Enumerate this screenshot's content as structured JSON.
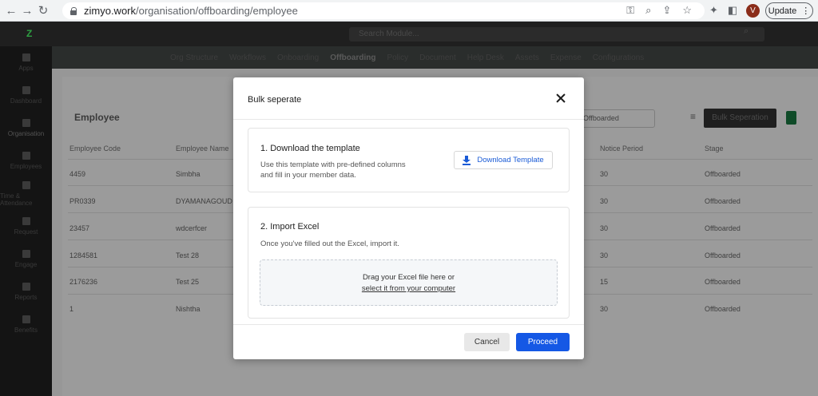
{
  "browser": {
    "url_domain": "zimyo.work",
    "url_path": "/organisation/offboarding/employee",
    "profile_initial": "V",
    "update_label": "Update"
  },
  "app": {
    "search_placeholder": "Search Module...",
    "menu": [
      "Org Structure",
      "Workflows",
      "Onboarding",
      "Offboarding",
      "Policy",
      "Document",
      "Help Desk",
      "Assets",
      "Expense",
      "Configurations"
    ],
    "active_menu": "Offboarding",
    "sidebar": [
      "Apps",
      "Dashboard",
      "Organisation",
      "Employees",
      "Time & Attendance",
      "Request",
      "Engage",
      "Reports",
      "Benefits"
    ],
    "page_title": "Employee",
    "filter_value": "Offboarded",
    "bulk_button": "Bulk Seperation",
    "columns": [
      "Employee Code",
      "Employee Name",
      "Notice Period",
      "Stage"
    ],
    "rows": [
      {
        "code": "4459",
        "name": "Simbha",
        "notice": "30",
        "stage": "Offboarded"
      },
      {
        "code": "PR0339",
        "name": "DYAMANAGOUD",
        "notice": "30",
        "stage": "Offboarded"
      },
      {
        "code": "23457",
        "name": "wdcerfcer",
        "notice": "30",
        "stage": "Offboarded"
      },
      {
        "code": "1284581",
        "name": "Test 28",
        "notice": "30",
        "stage": "Offboarded"
      },
      {
        "code": "2176236",
        "name": "Test 25",
        "notice": "15",
        "stage": "Offboarded"
      },
      {
        "code": "1",
        "name": "Nishtha",
        "notice": "30",
        "stage": "Offboarded"
      }
    ]
  },
  "modal": {
    "title": "Bulk seperate",
    "step1": {
      "heading": "1. Download the template",
      "text_line1": "Use this template with pre-defined columns",
      "text_line2": "and fill in your member data.",
      "button": "Download Template"
    },
    "step2": {
      "heading": "2. Import Excel",
      "text": "Once you've filled out the Excel, import it.",
      "drop_line1": "Drag your Excel file here or",
      "drop_link": "select it from your computer"
    },
    "cancel": "Cancel",
    "proceed": "Proceed"
  },
  "colors": {
    "primary": "#1558e5",
    "link": "#1a5bd6"
  }
}
